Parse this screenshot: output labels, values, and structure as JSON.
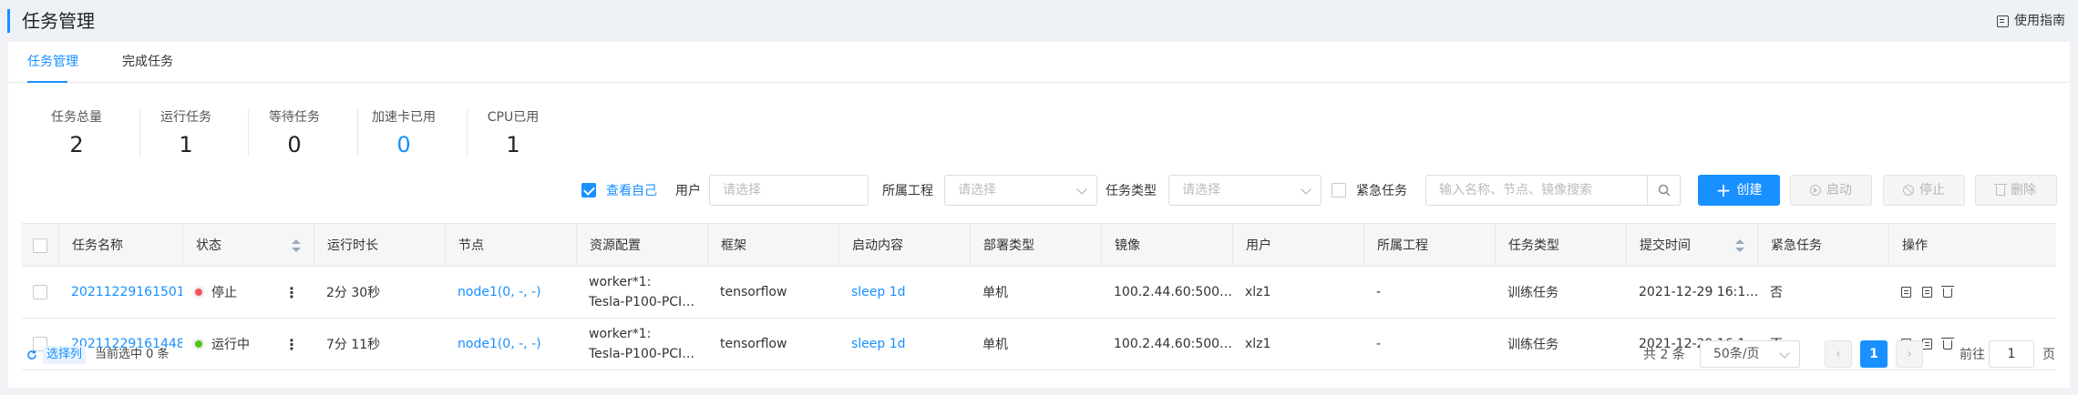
{
  "header": {
    "title": "任务管理",
    "guide_label": "使用指南"
  },
  "tabs": [
    {
      "label": "任务管理",
      "active": true
    },
    {
      "label": "完成任务",
      "active": false
    }
  ],
  "stats": [
    {
      "label": "任务总量",
      "value": "2"
    },
    {
      "label": "运行任务",
      "value": "1"
    },
    {
      "label": "等待任务",
      "value": "0"
    },
    {
      "label": "加速卡已用",
      "value": "0"
    },
    {
      "label": "CPU已用",
      "value": "1"
    }
  ],
  "filters": {
    "view_self_label": "查看自己",
    "view_self_checked": true,
    "user_label": "用户",
    "user_placeholder": "请选择",
    "project_label": "所属工程",
    "project_placeholder": "请选择",
    "type_label": "任务类型",
    "type_placeholder": "请选择",
    "urgent_label": "紧急任务",
    "search_placeholder": "输入名称、节点、镜像搜索"
  },
  "buttons": {
    "create": "创建",
    "start": "启动",
    "stop": "停止",
    "delete": "删除"
  },
  "table": {
    "columns": [
      "任务名称",
      "状态",
      "运行时长",
      "节点",
      "资源配置",
      "框架",
      "启动内容",
      "部署类型",
      "镜像",
      "用户",
      "所属工程",
      "任务类型",
      "提交时间",
      "紧急任务",
      "操作"
    ],
    "rows": [
      {
        "name": "20211229161501",
        "status": "停止",
        "status_color": "#f5545c",
        "duration": "2分 30秒",
        "node": "node1(0, -, -)",
        "res_line1": "worker*1:",
        "res_line2": "Tesla-P100-PCI…",
        "framework": "tensorflow",
        "command": "sleep 1d",
        "deploy": "单机",
        "image": "100.2.44.60:500…",
        "user": "xlz1",
        "project": "-",
        "task_type": "训练任务",
        "submit_time": "2021-12-29 16:1…",
        "urgent": "否"
      },
      {
        "name": "20211229161448",
        "status": "运行中",
        "status_color": "#52c41a",
        "duration": "7分 11秒",
        "node": "node1(0, -, -)",
        "res_line1": "worker*1:",
        "res_line2": "Tesla-P100-PCI…",
        "framework": "tensorflow",
        "command": "sleep 1d",
        "deploy": "单机",
        "image": "100.2.44.60:500…",
        "user": "xlz1",
        "project": "-",
        "task_type": "训练任务",
        "submit_time": "2021-12-29 16:1…",
        "urgent": "否"
      }
    ]
  },
  "footer": {
    "select_columns": "选择列",
    "selected_text": "当前选中 0 条",
    "total": "共 2 条",
    "page_size": "50条/页",
    "current_page": "1",
    "goto_prefix": "前往",
    "goto_value": "1",
    "goto_suffix": "页"
  },
  "colors": {
    "accent": "#1890ff",
    "stop": "#f5545c",
    "running": "#52c41a"
  }
}
